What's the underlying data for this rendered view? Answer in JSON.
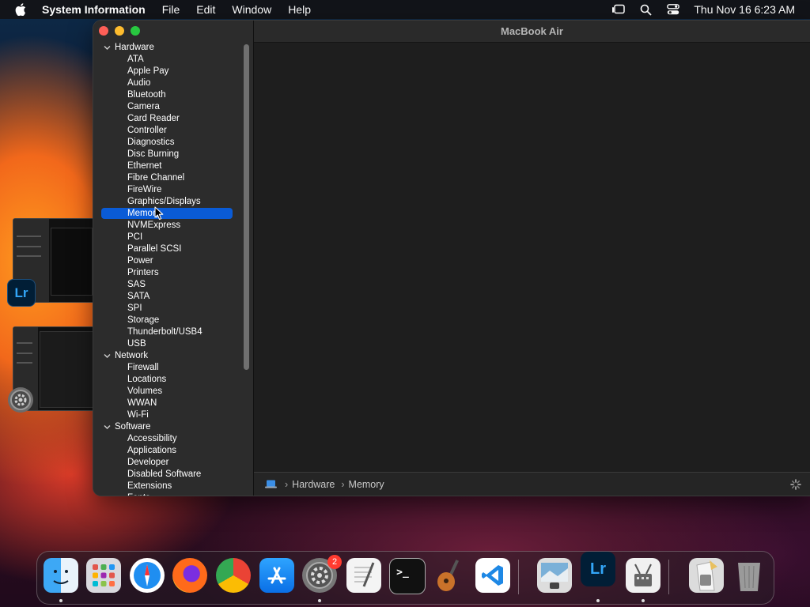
{
  "menubar": {
    "app_name": "System Information",
    "items": [
      "File",
      "Edit",
      "Window",
      "Help"
    ],
    "clock": "Thu Nov 16  6:23 AM"
  },
  "window": {
    "title": "MacBook Air",
    "tree": [
      {
        "type": "cat",
        "label": "Hardware"
      },
      {
        "type": "item",
        "label": "ATA"
      },
      {
        "type": "item",
        "label": "Apple Pay"
      },
      {
        "type": "item",
        "label": "Audio"
      },
      {
        "type": "item",
        "label": "Bluetooth"
      },
      {
        "type": "item",
        "label": "Camera"
      },
      {
        "type": "item",
        "label": "Card Reader"
      },
      {
        "type": "item",
        "label": "Controller"
      },
      {
        "type": "item",
        "label": "Diagnostics"
      },
      {
        "type": "item",
        "label": "Disc Burning"
      },
      {
        "type": "item",
        "label": "Ethernet"
      },
      {
        "type": "item",
        "label": "Fibre Channel"
      },
      {
        "type": "item",
        "label": "FireWire"
      },
      {
        "type": "item",
        "label": "Graphics/Displays"
      },
      {
        "type": "item",
        "label": "Memory",
        "selected": true
      },
      {
        "type": "item",
        "label": "NVMExpress"
      },
      {
        "type": "item",
        "label": "PCI"
      },
      {
        "type": "item",
        "label": "Parallel SCSI"
      },
      {
        "type": "item",
        "label": "Power"
      },
      {
        "type": "item",
        "label": "Printers"
      },
      {
        "type": "item",
        "label": "SAS"
      },
      {
        "type": "item",
        "label": "SATA"
      },
      {
        "type": "item",
        "label": "SPI"
      },
      {
        "type": "item",
        "label": "Storage"
      },
      {
        "type": "item",
        "label": "Thunderbolt/USB4"
      },
      {
        "type": "item",
        "label": "USB"
      },
      {
        "type": "cat",
        "label": "Network"
      },
      {
        "type": "item",
        "label": "Firewall"
      },
      {
        "type": "item",
        "label": "Locations"
      },
      {
        "type": "item",
        "label": "Volumes"
      },
      {
        "type": "item",
        "label": "WWAN"
      },
      {
        "type": "item",
        "label": "Wi-Fi"
      },
      {
        "type": "cat",
        "label": "Software"
      },
      {
        "type": "item",
        "label": "Accessibility"
      },
      {
        "type": "item",
        "label": "Applications"
      },
      {
        "type": "item",
        "label": "Developer"
      },
      {
        "type": "item",
        "label": "Disabled Software"
      },
      {
        "type": "item",
        "label": "Extensions"
      },
      {
        "type": "item",
        "label": "Fonts"
      }
    ],
    "path": [
      "Hardware",
      "Memory"
    ]
  },
  "stage": {
    "lightroom_label": "Lr"
  },
  "dock": {
    "apps": [
      {
        "name": "Finder",
        "icon": "finder-icon",
        "running": true
      },
      {
        "name": "Launchpad",
        "icon": "launchpad-icon",
        "running": false
      },
      {
        "name": "Safari",
        "icon": "safari-icon",
        "running": false
      },
      {
        "name": "Firefox",
        "icon": "firefox-icon",
        "running": false
      },
      {
        "name": "Chrome",
        "icon": "chrome-icon",
        "running": false
      },
      {
        "name": "App Store",
        "icon": "app-store-icon",
        "running": false
      },
      {
        "name": "System Settings",
        "icon": "system-settings-icon",
        "running": true,
        "badge": "2"
      },
      {
        "name": "TextEdit",
        "icon": "textedit-icon",
        "running": false
      },
      {
        "name": "Terminal",
        "icon": "terminal-icon",
        "running": false
      },
      {
        "name": "GarageBand",
        "icon": "garageband-icon",
        "running": false
      },
      {
        "name": "VS Code",
        "icon": "vscode-icon",
        "running": false
      },
      {
        "name": "Preview",
        "icon": "preview-icon",
        "running": false
      },
      {
        "name": "Lightroom",
        "icon": "lightroom-icon",
        "running": true,
        "label": "Lr"
      },
      {
        "name": "System Information",
        "icon": "system-information-icon",
        "running": true
      },
      {
        "name": "Downloads",
        "icon": "downloads-stack-icon",
        "running": false
      },
      {
        "name": "Trash",
        "icon": "trash-icon",
        "running": false
      }
    ],
    "badge_color": "#ff3b30"
  },
  "colors": {
    "selection": "#0a5bd6",
    "sidebar_bg": "#2c2c2c",
    "content_bg": "#1e1e1e"
  }
}
